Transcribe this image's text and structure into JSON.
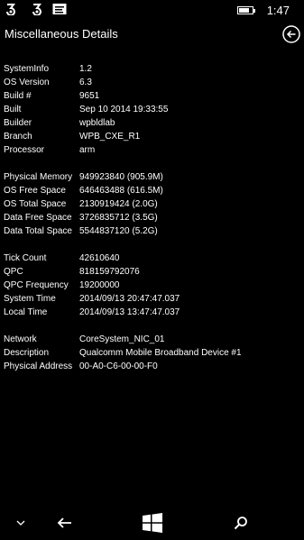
{
  "status": {
    "time": "1:47",
    "battery_level": 0.75
  },
  "header": {
    "title": "Miscellaneous Details"
  },
  "system": [
    {
      "label": "SystemInfo",
      "value": "1.2"
    },
    {
      "label": "OS Version",
      "value": "6.3"
    },
    {
      "label": "Build #",
      "value": "9651"
    },
    {
      "label": "Built",
      "value": "Sep 10 2014 19:33:55"
    },
    {
      "label": "Builder",
      "value": "wpbldlab"
    },
    {
      "label": "Branch",
      "value": "WPB_CXE_R1"
    },
    {
      "label": "Processor",
      "value": "arm"
    }
  ],
  "memory": [
    {
      "label": "Physical Memory",
      "value": "949923840 (905.9M)"
    },
    {
      "label": "OS Free Space",
      "value": "646463488 (616.5M)"
    },
    {
      "label": "OS Total Space",
      "value": "2130919424 (2.0G)"
    },
    {
      "label": "Data Free Space",
      "value": "3726835712 (3.5G)"
    },
    {
      "label": "Data Total Space",
      "value": "5544837120 (5.2G)"
    }
  ],
  "timing": [
    {
      "label": "Tick Count",
      "value": "42610640"
    },
    {
      "label": "QPC",
      "value": "818159792076"
    },
    {
      "label": "QPC Frequency",
      "value": "19200000"
    },
    {
      "label": "System Time",
      "value": "2014/09/13 20:47:47.037"
    },
    {
      "label": "Local Time",
      "value": "2014/09/13 13:47:47.037"
    }
  ],
  "network": [
    {
      "label": "Network",
      "value": "CoreSystem_NIC_01"
    },
    {
      "label": "Description",
      "value": "Qualcomm Mobile Broadband Device #1"
    },
    {
      "label": "Physical Address",
      "value": "00-A0-C6-00-00-F0"
    }
  ]
}
